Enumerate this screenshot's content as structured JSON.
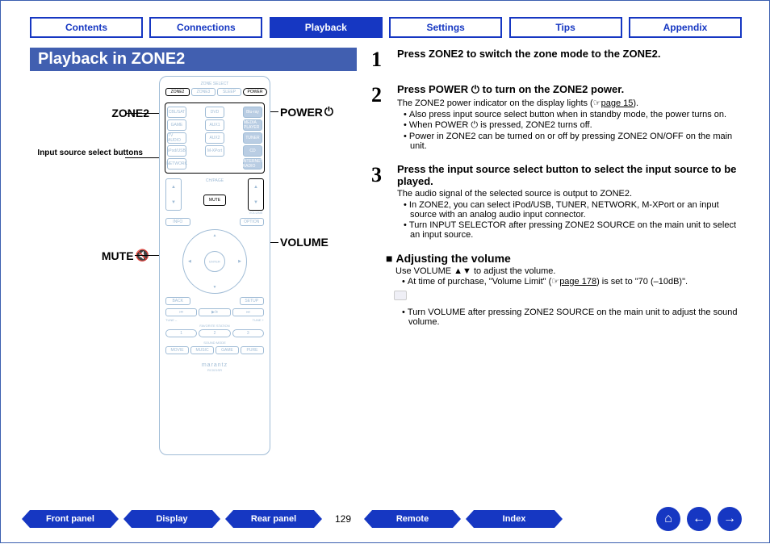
{
  "tabs": {
    "contents": "Contents",
    "connections": "Connections",
    "playback": "Playback",
    "settings": "Settings",
    "tips": "Tips",
    "appendix": "Appendix"
  },
  "banner": "Playback in ZONE2",
  "labels": {
    "zone2": "ZONE2",
    "power": "POWER",
    "input_source": "Input source select buttons",
    "mute": "MUTE",
    "volume": "VOLUME"
  },
  "remote": {
    "zone_select": "ZONE SELECT",
    "zone2_btn": "ZONE2",
    "zone3_btn": "ZONE3",
    "sleep_btn": "SLEEP",
    "power_btn": "POWER",
    "src": {
      "cbl": "CBL/SAT",
      "dvd": "DVD",
      "bluray": "Blu-ray",
      "game": "GAME",
      "aux1": "AUX1",
      "media": "MEDIA PLAYER",
      "tv": "TV AUDIO",
      "aux2": "AUX2",
      "tuner": "TUNER",
      "ipod": "iPod/USB",
      "mxport": "M-XPort",
      "cd": "CD",
      "network": "NETWORK",
      "internet": "INTERNET RADIO"
    },
    "ch_page": "CH/PAGE",
    "mute_lbl": "MUTE",
    "volume_lbl": "VOLUME",
    "info": "INFO",
    "option": "OPTION",
    "back": "BACK",
    "setup": "SETUP",
    "enter": "ENTER",
    "tune_minus": "TUNE –",
    "tune_plus": "TUNE +",
    "fav_station": "FAVORITE STATION",
    "n1": "1",
    "n2": "2",
    "n3": "3",
    "sound_mode": "SOUND MODE",
    "movie": "MOVIE",
    "music": "MUSIC",
    "game_sm": "GAME",
    "pure": "PURE",
    "brand": "marantz",
    "model": "RC021SR"
  },
  "steps": {
    "s1": {
      "title": "Press ZONE2 to switch the zone mode to the ZONE2."
    },
    "s2": {
      "title_a": "Press POWER ",
      "title_b": " to turn on the ZONE2 power.",
      "line1_a": "The ZONE2 power indicator on the display lights (",
      "line1_link": "page 15",
      "line1_b": ").",
      "b1": "Also press input source select button when in standby mode, the power turns on.",
      "b2_a": "When POWER ",
      "b2_b": " is pressed, ZONE2 turns off.",
      "b3": "Power in ZONE2 can be turned on or off by pressing ZONE2 ON/OFF on the main unit."
    },
    "s3": {
      "title": "Press the input source select button to select the input source to be played.",
      "line1": "The audio signal of the selected source is output to ZONE2.",
      "b1": "In ZONE2, you can select iPod/USB, TUNER, NETWORK, M-XPort or an input source with an analog audio input connector.",
      "b2": "Turn INPUT SELECTOR after pressing ZONE2 SOURCE on the main unit to select an input source."
    }
  },
  "adjust": {
    "heading": "Adjusting the volume",
    "line1_a": "Use VOLUME ",
    "line1_b": " to adjust the volume.",
    "b1_a": "At time of purchase, \"Volume Limit\" (",
    "b1_link": "page 178",
    "b1_b": ") is set to \"70 (–10dB)\".",
    "note": "Turn VOLUME after pressing ZONE2 SOURCE on the main unit to adjust the sound volume."
  },
  "footer": {
    "front": "Front panel",
    "display": "Display",
    "rear": "Rear panel",
    "remote": "Remote",
    "index": "Index",
    "page": "129"
  }
}
